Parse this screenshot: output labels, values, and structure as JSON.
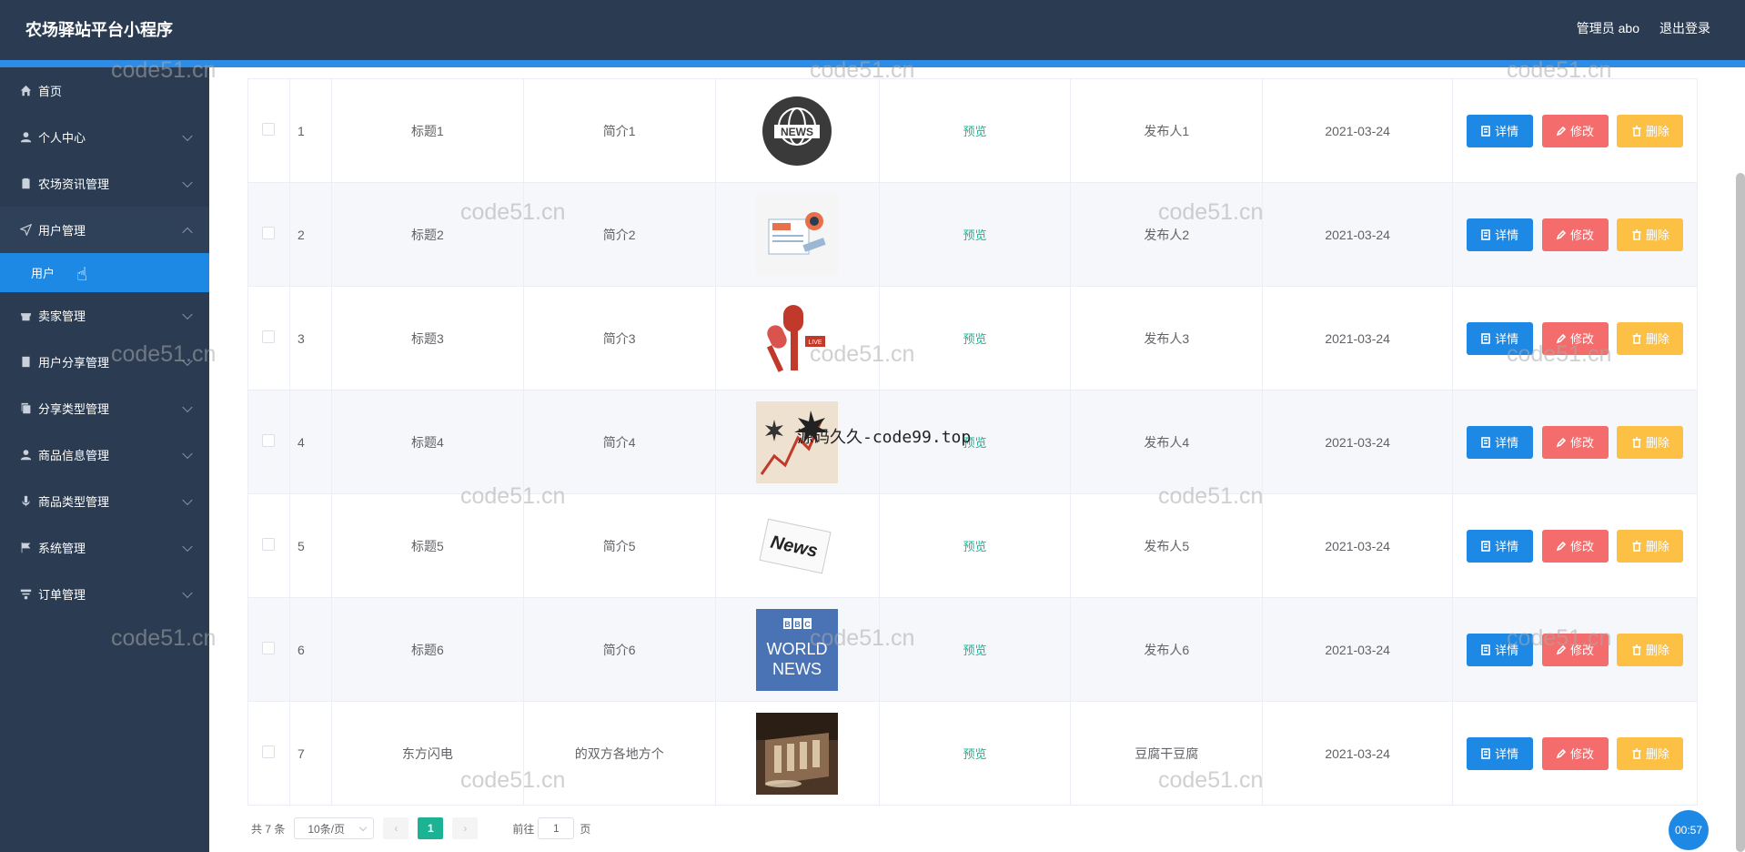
{
  "header": {
    "title": "农场驿站平台小程序",
    "admin_label": "管理员 abo",
    "logout_label": "退出登录"
  },
  "sidebar": {
    "items": [
      {
        "label": "首页",
        "icon": "home-icon"
      },
      {
        "label": "个人中心",
        "icon": "user-icon"
      },
      {
        "label": "农场资讯管理",
        "icon": "clipboard-icon"
      },
      {
        "label": "用户管理",
        "icon": "send-icon"
      },
      {
        "label": "卖家管理",
        "icon": "store-icon"
      },
      {
        "label": "用户分享管理",
        "icon": "document-icon"
      },
      {
        "label": "分享类型管理",
        "icon": "copy-icon"
      },
      {
        "label": "商品信息管理",
        "icon": "user-icon"
      },
      {
        "label": "商品类型管理",
        "icon": "microphone-icon"
      },
      {
        "label": "系统管理",
        "icon": "flag-icon"
      },
      {
        "label": "订单管理",
        "icon": "filter-icon"
      }
    ],
    "submenu": {
      "label": "用户"
    }
  },
  "table": {
    "preview_label": "预览",
    "detail_label": "详情",
    "edit_label": "修改",
    "delete_label": "删除",
    "rows": [
      {
        "idx": "1",
        "title": "标题1",
        "intro": "简介1",
        "image": "news-globe-icon",
        "publisher": "发布人1",
        "date": "2021-03-24"
      },
      {
        "idx": "2",
        "title": "标题2",
        "intro": "简介2",
        "image": "newspaper-illustration",
        "publisher": "发布人2",
        "date": "2021-03-24"
      },
      {
        "idx": "3",
        "title": "标题3",
        "intro": "简介3",
        "image": "microphone-illustration",
        "publisher": "发布人3",
        "date": "2021-03-24"
      },
      {
        "idx": "4",
        "title": "标题4",
        "intro": "简介4",
        "image": "chart-explosion-illustration",
        "publisher": "发布人4",
        "date": "2021-03-24"
      },
      {
        "idx": "5",
        "title": "标题5",
        "intro": "简介5",
        "image": "news-paper-icon",
        "publisher": "发布人5",
        "date": "2021-03-24"
      },
      {
        "idx": "6",
        "title": "标题6",
        "intro": "简介6",
        "image": "bbc-world-news-logo",
        "publisher": "发布人6",
        "date": "2021-03-24"
      },
      {
        "idx": "7",
        "title": "东方闪电",
        "intro": "的双方各地方个",
        "image": "interior-photo",
        "publisher": "豆腐干豆腐",
        "date": "2021-03-24"
      }
    ]
  },
  "pagination": {
    "total": "共 7 条",
    "page_size": "10条/页",
    "current_page": "1",
    "goto_label": "前往",
    "goto_value": "1",
    "page_suffix": "页"
  },
  "overlay": {
    "watermark": "code51.cn",
    "center_watermark": "源码久久-code99.top",
    "timer": "00:57"
  },
  "colors": {
    "header_bg": "#2b3c52",
    "accent_blue": "#1e88e5",
    "edit_red": "#f56c6c",
    "delete_yellow": "#fcc044",
    "preview_green": "#1bb394"
  }
}
